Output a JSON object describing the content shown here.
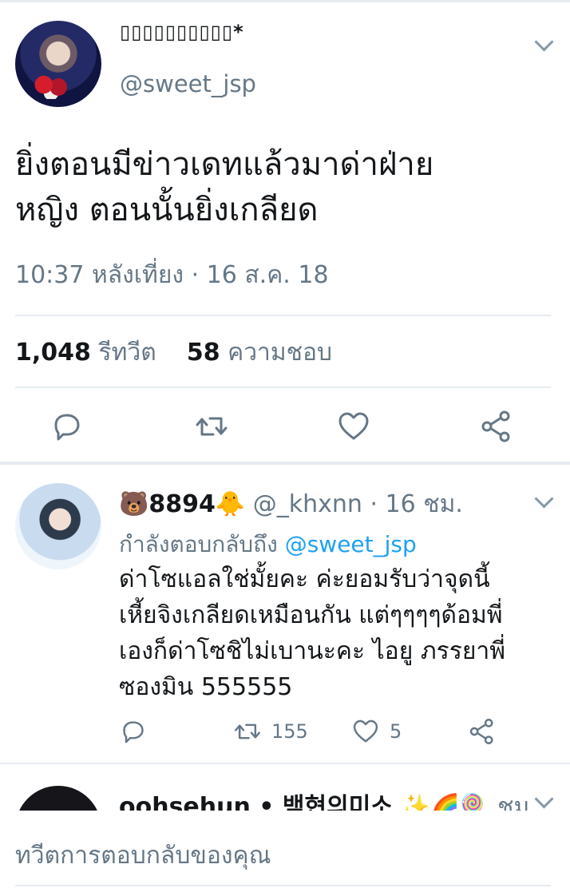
{
  "main_tweet": {
    "display_name": "▯▯▯▯▯▯▯▯▯▯*",
    "handle": "@sweet_jsp",
    "text_line1": "ยิ่งตอนมีข่าวเดทแล้วมาด่าฝ่าย",
    "text_line2": "หญิง ตอนนั้นยิ่งเกลียด",
    "timestamp": "10:37 หลังเที่ยง · 16 ส.ค. 18",
    "retweet_count": "1,048",
    "retweet_label": "รีทวีต",
    "like_count": "58",
    "like_label": "ความชอบ"
  },
  "reply": {
    "emoji_bear": "🐻",
    "display_name": "8894",
    "emoji_chick": "🐥",
    "handle": "@_khxnn",
    "time": "· 16 ชม.",
    "replying_label": "กำลังตอบกลับถึง",
    "replying_to": "@sweet_jsp",
    "text_line1": "ด่าโซแอลใช่มั้ยคะ ค่ะยอมรับว่าจุดนี้",
    "text_line2": "เหี้ยจิงเกลียดเหมือนกัน แต่ๆๆๆๆด้อมพี่",
    "text_line3": "เองก็ด่าโซชิไม่เบานะคะ  ไอยู ภรรยาพี่",
    "text_line4": "ซองมิน 555555",
    "retweet_count": "155",
    "like_count": "5"
  },
  "third_tweet": {
    "display_name": "oohsehun • 백현의미소",
    "emojis": "✨🌈🍭",
    "time": "ชม."
  },
  "compose": {
    "placeholder": "ทวีตการตอบกลับของคุณ"
  },
  "colors": {
    "text": "#14171a",
    "secondary": "#657786",
    "link": "#1da1f2",
    "divider": "#e6ecf0"
  },
  "icons": [
    "reply-icon",
    "retweet-icon",
    "like-icon",
    "share-icon",
    "chevron-down-icon"
  ]
}
